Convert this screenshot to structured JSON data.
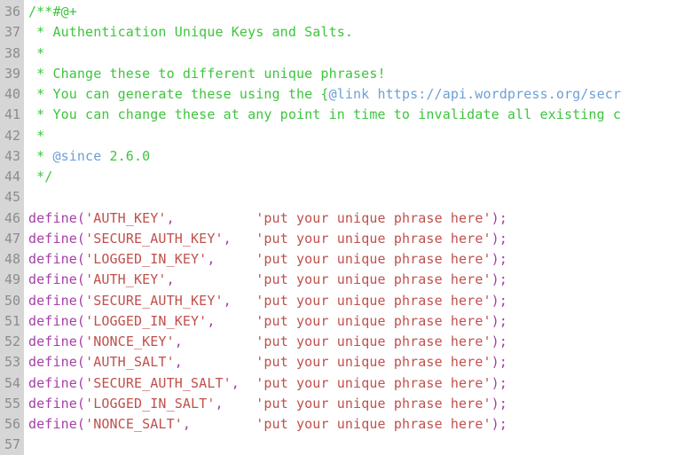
{
  "editor": {
    "kind": "code-editor-pane",
    "language": "php",
    "background_color": "#ffffff",
    "gutter_background_color": "#d6d6d6",
    "gutter_text_color": "#8c8c8c",
    "first_line_number": 36,
    "last_line_number": 57,
    "syntax_colors": {
      "comment": "#3fc43f",
      "doc_tag": "#6c9fd8",
      "link": "#6c9fd8",
      "function": "#a53fa5",
      "punctuation": "#a53fa5",
      "string": "#c0504d"
    }
  },
  "lines": [
    {
      "number": "36",
      "text": "/**#@+",
      "tokens": [
        {
          "type": "comment",
          "text": "/**#@+"
        }
      ]
    },
    {
      "number": "37",
      "text": " * Authentication Unique Keys and Salts.",
      "tokens": [
        {
          "type": "comment",
          "text": " * Authentication Unique Keys and Salts."
        }
      ]
    },
    {
      "number": "38",
      "text": " *",
      "tokens": [
        {
          "type": "comment",
          "text": " *"
        }
      ]
    },
    {
      "number": "39",
      "text": " * Change these to different unique phrases!",
      "tokens": [
        {
          "type": "comment",
          "text": " * Change these to different unique phrases!"
        }
      ]
    },
    {
      "number": "40",
      "text": " * You can generate these using the {@link https://api.wordpress.org/secr",
      "tokens": [
        {
          "type": "comment",
          "text": " * You can generate these using the {"
        },
        {
          "type": "doc_tag",
          "text": "@link"
        },
        {
          "type": "comment",
          "text": " "
        },
        {
          "type": "link",
          "text": "https://api.wordpress.org/secr"
        }
      ]
    },
    {
      "number": "41",
      "text": " * You can change these at any point in time to invalidate all existing c",
      "tokens": [
        {
          "type": "comment",
          "text": " * You can change these at any point in time to invalidate all existing c"
        }
      ]
    },
    {
      "number": "42",
      "text": " *",
      "tokens": [
        {
          "type": "comment",
          "text": " *"
        }
      ]
    },
    {
      "number": "43",
      "text": " * @since 2.6.0",
      "tokens": [
        {
          "type": "comment",
          "text": " * "
        },
        {
          "type": "doc_tag",
          "text": "@since"
        },
        {
          "type": "comment",
          "text": " 2.6.0"
        }
      ]
    },
    {
      "number": "44",
      "text": " */",
      "tokens": [
        {
          "type": "comment",
          "text": " */"
        }
      ]
    },
    {
      "number": "45",
      "text": "",
      "tokens": []
    },
    {
      "number": "46",
      "text": "define('AUTH_KEY',          'put your unique phrase here');",
      "tokens": [
        {
          "type": "function",
          "text": "define("
        },
        {
          "type": "string",
          "text": "'AUTH_KEY'"
        },
        {
          "type": "punctuation",
          "text": ","
        },
        {
          "type": "plain",
          "text": "          "
        },
        {
          "type": "string",
          "text": "'put your unique phrase here'"
        },
        {
          "type": "punctuation",
          "text": ");"
        }
      ]
    },
    {
      "number": "47",
      "text": "define('SECURE_AUTH_KEY',   'put your unique phrase here');",
      "tokens": [
        {
          "type": "function",
          "text": "define("
        },
        {
          "type": "string",
          "text": "'SECURE_AUTH_KEY'"
        },
        {
          "type": "punctuation",
          "text": ","
        },
        {
          "type": "plain",
          "text": "   "
        },
        {
          "type": "string",
          "text": "'put your unique phrase here'"
        },
        {
          "type": "punctuation",
          "text": ");"
        }
      ]
    },
    {
      "number": "48",
      "text": "define('LOGGED_IN_KEY',     'put your unique phrase here');",
      "tokens": [
        {
          "type": "function",
          "text": "define("
        },
        {
          "type": "string",
          "text": "'LOGGED_IN_KEY'"
        },
        {
          "type": "punctuation",
          "text": ","
        },
        {
          "type": "plain",
          "text": "     "
        },
        {
          "type": "string",
          "text": "'put your unique phrase here'"
        },
        {
          "type": "punctuation",
          "text": ");"
        }
      ]
    },
    {
      "number": "49",
      "text": "define('AUTH_KEY',          'put your unique phrase here');",
      "tokens": [
        {
          "type": "function",
          "text": "define("
        },
        {
          "type": "string",
          "text": "'AUTH_KEY'"
        },
        {
          "type": "punctuation",
          "text": ","
        },
        {
          "type": "plain",
          "text": "          "
        },
        {
          "type": "string",
          "text": "'put your unique phrase here'"
        },
        {
          "type": "punctuation",
          "text": ");"
        }
      ]
    },
    {
      "number": "50",
      "text": "define('SECURE_AUTH_KEY',   'put your unique phrase here');",
      "tokens": [
        {
          "type": "function",
          "text": "define("
        },
        {
          "type": "string",
          "text": "'SECURE_AUTH_KEY'"
        },
        {
          "type": "punctuation",
          "text": ","
        },
        {
          "type": "plain",
          "text": "   "
        },
        {
          "type": "string",
          "text": "'put your unique phrase here'"
        },
        {
          "type": "punctuation",
          "text": ");"
        }
      ]
    },
    {
      "number": "51",
      "text": "define('LOGGED_IN_KEY',     'put your unique phrase here');",
      "tokens": [
        {
          "type": "function",
          "text": "define("
        },
        {
          "type": "string",
          "text": "'LOGGED_IN_KEY'"
        },
        {
          "type": "punctuation",
          "text": ","
        },
        {
          "type": "plain",
          "text": "     "
        },
        {
          "type": "string",
          "text": "'put your unique phrase here'"
        },
        {
          "type": "punctuation",
          "text": ");"
        }
      ]
    },
    {
      "number": "52",
      "text": "define('NONCE_KEY',         'put your unique phrase here');",
      "tokens": [
        {
          "type": "function",
          "text": "define("
        },
        {
          "type": "string",
          "text": "'NONCE_KEY'"
        },
        {
          "type": "punctuation",
          "text": ","
        },
        {
          "type": "plain",
          "text": "         "
        },
        {
          "type": "string",
          "text": "'put your unique phrase here'"
        },
        {
          "type": "punctuation",
          "text": ");"
        }
      ]
    },
    {
      "number": "53",
      "text": "define('AUTH_SALT',         'put your unique phrase here');",
      "tokens": [
        {
          "type": "function",
          "text": "define("
        },
        {
          "type": "string",
          "text": "'AUTH_SALT'"
        },
        {
          "type": "punctuation",
          "text": ","
        },
        {
          "type": "plain",
          "text": "         "
        },
        {
          "type": "string",
          "text": "'put your unique phrase here'"
        },
        {
          "type": "punctuation",
          "text": ");"
        }
      ]
    },
    {
      "number": "54",
      "text": "define('SECURE_AUTH_SALT',  'put your unique phrase here');",
      "tokens": [
        {
          "type": "function",
          "text": "define("
        },
        {
          "type": "string",
          "text": "'SECURE_AUTH_SALT'"
        },
        {
          "type": "punctuation",
          "text": ","
        },
        {
          "type": "plain",
          "text": "  "
        },
        {
          "type": "string",
          "text": "'put your unique phrase here'"
        },
        {
          "type": "punctuation",
          "text": ");"
        }
      ]
    },
    {
      "number": "55",
      "text": "define('LOGGED_IN_SALT',    'put your unique phrase here');",
      "tokens": [
        {
          "type": "function",
          "text": "define("
        },
        {
          "type": "string",
          "text": "'LOGGED_IN_SALT'"
        },
        {
          "type": "punctuation",
          "text": ","
        },
        {
          "type": "plain",
          "text": "    "
        },
        {
          "type": "string",
          "text": "'put your unique phrase here'"
        },
        {
          "type": "punctuation",
          "text": ");"
        }
      ]
    },
    {
      "number": "56",
      "text": "define('NONCE_SALT',        'put your unique phrase here');",
      "tokens": [
        {
          "type": "function",
          "text": "define("
        },
        {
          "type": "string",
          "text": "'NONCE_SALT'"
        },
        {
          "type": "punctuation",
          "text": ","
        },
        {
          "type": "plain",
          "text": "        "
        },
        {
          "type": "string",
          "text": "'put your unique phrase here'"
        },
        {
          "type": "punctuation",
          "text": ");"
        }
      ]
    },
    {
      "number": "57",
      "text": "",
      "tokens": []
    }
  ]
}
